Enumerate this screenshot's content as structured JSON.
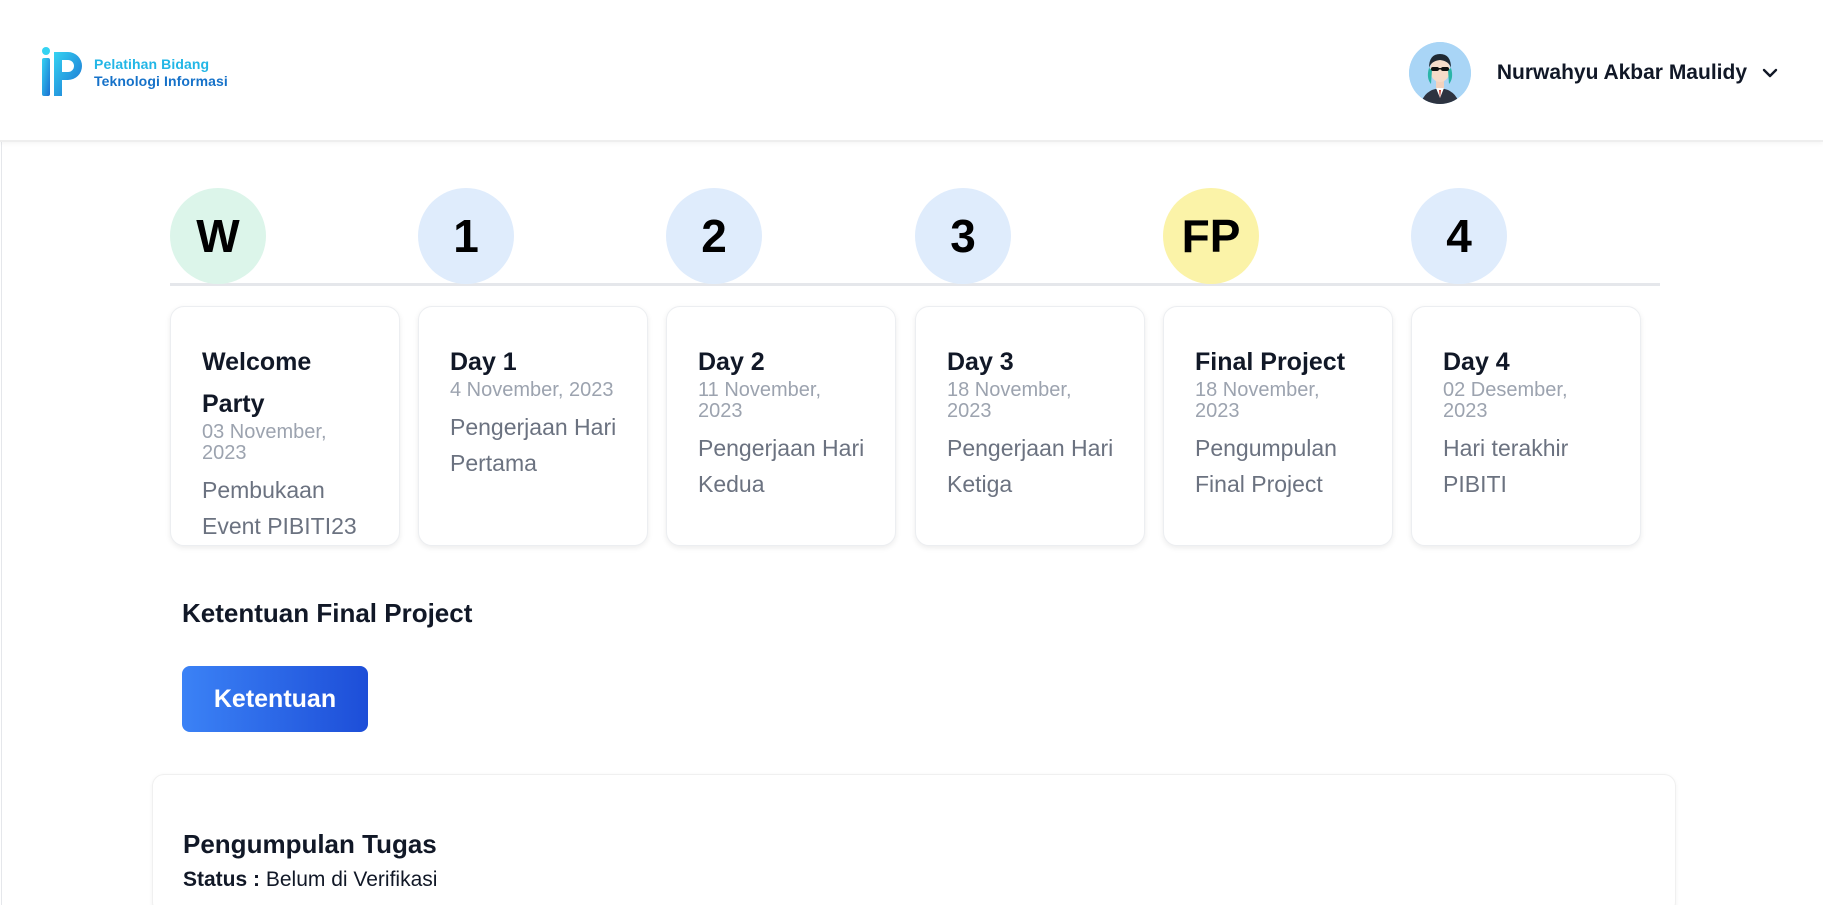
{
  "brand": {
    "line1": "Pelatihan Bidang",
    "line2": "Teknologi Informasi"
  },
  "user": {
    "name": "Nurwahyu Akbar Maulidy"
  },
  "timeline": {
    "badges": [
      {
        "label": "W",
        "color": "#dcf5ea"
      },
      {
        "label": "1",
        "color": "#dfecfc"
      },
      {
        "label": "2",
        "color": "#dfecfc"
      },
      {
        "label": "3",
        "color": "#dfecfc"
      },
      {
        "label": "FP",
        "color": "#fbf3a8"
      },
      {
        "label": "4",
        "color": "#dfecfc"
      }
    ],
    "cards": [
      {
        "title": "Welcome Party",
        "date": "03 November, 2023",
        "desc": "Pembukaan Event PIBITI23"
      },
      {
        "title": "Day 1",
        "date": "4 November, 2023",
        "desc": "Pengerjaan Hari Pertama"
      },
      {
        "title": "Day 2",
        "date": "11 November, 2023",
        "desc": "Pengerjaan Hari Kedua"
      },
      {
        "title": "Day 3",
        "date": "18 November, 2023",
        "desc": "Pengerjaan Hari Ketiga"
      },
      {
        "title": "Final Project",
        "date": "18 November, 2023",
        "desc": "Pengumpulan Final Project"
      },
      {
        "title": "Day 4",
        "date": "02 Desember, 2023",
        "desc": "Hari terakhir PIBITI"
      }
    ]
  },
  "rules": {
    "title": "Ketentuan Final Project",
    "button_label": "Ketentuan"
  },
  "submission": {
    "title": "Pengumpulan Tugas",
    "status_label": "Status :",
    "status_value": "Belum di Verifikasi"
  },
  "icons": {
    "logo": "pibiti-logo-icon",
    "chevron": "chevron-down-icon",
    "avatar": "user-avatar"
  },
  "colors": {
    "button_start": "#3b82f6",
    "button_end": "#1d4ed8",
    "brand_light": "#22b6e6",
    "brand_dark": "#1672c9"
  }
}
